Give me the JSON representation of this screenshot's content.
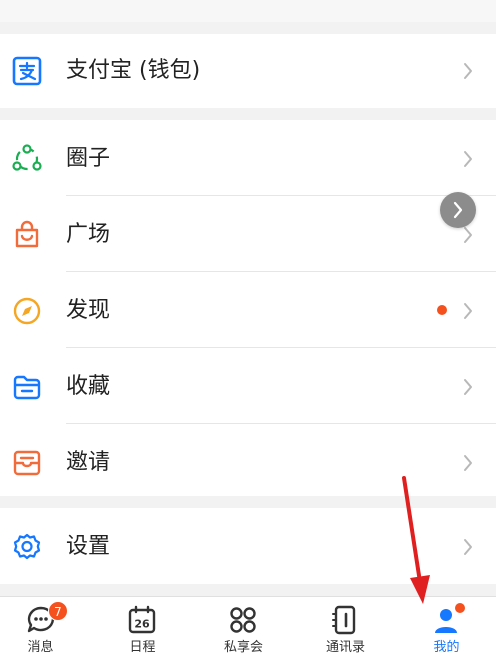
{
  "menu": {
    "alipay": {
      "label": "支付宝 (钱包)",
      "icon": "alipay-icon"
    },
    "items": [
      {
        "label": "圈子",
        "icon": "circle-group-icon"
      },
      {
        "label": "广场",
        "icon": "shopping-bag-icon"
      },
      {
        "label": "发现",
        "icon": "compass-icon"
      },
      {
        "label": "收藏",
        "icon": "folder-icon"
      },
      {
        "label": "邀请",
        "icon": "invite-envelope-icon"
      }
    ],
    "settings": {
      "label": "设置",
      "icon": "gear-icon"
    }
  },
  "tabbar": {
    "tabs": [
      {
        "label": "消息",
        "icon": "message-icon",
        "badge": "7"
      },
      {
        "label": "日程",
        "icon": "calendar-icon",
        "day": "26"
      },
      {
        "label": "私享会",
        "icon": "grid-icon"
      },
      {
        "label": "通讯录",
        "icon": "contacts-icon"
      },
      {
        "label": "我的",
        "icon": "profile-icon",
        "active": true
      }
    ]
  },
  "colors": {
    "accent": "#1677ff",
    "badge": "#f4511e",
    "circle_green": "#1aad52",
    "bag_orange": "#f26b3a",
    "compass_yellow": "#f5a623",
    "folder_blue": "#1677ff",
    "invite_orange": "#f26b3a"
  }
}
